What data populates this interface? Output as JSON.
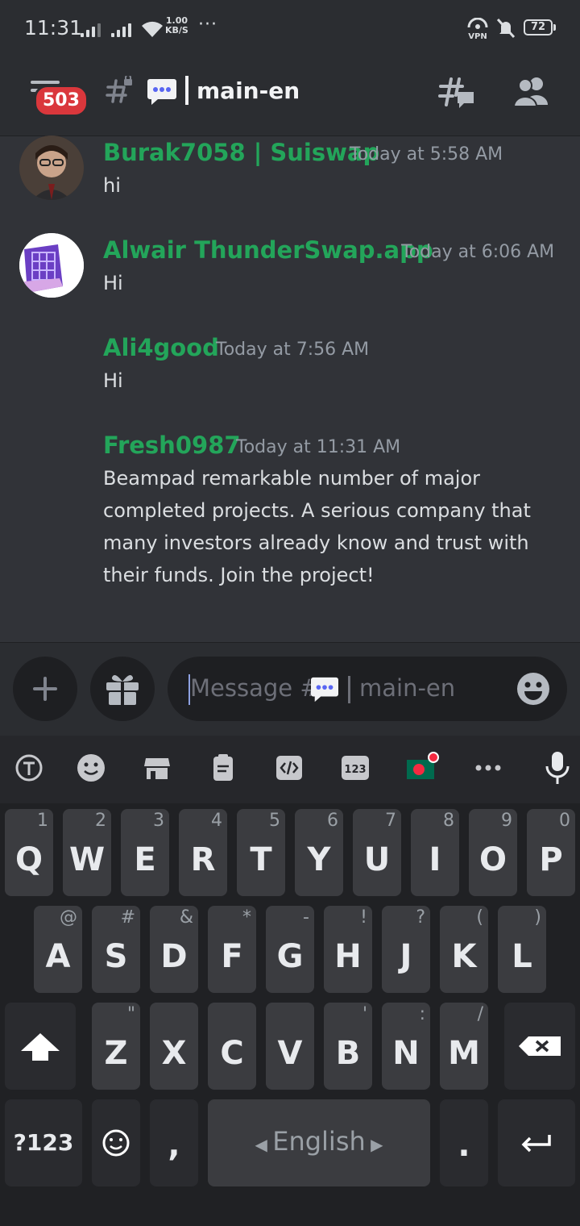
{
  "status_bar": {
    "time": "11:31",
    "net_speed_value": "1.00",
    "net_speed_unit": "KB/S",
    "vpn_label": "VPN",
    "battery_level": "72",
    "more_dots": "···"
  },
  "header": {
    "unread_count": "503",
    "channel_name": "main-en"
  },
  "messages": [
    {
      "author": "Burak7058 | Suiswap",
      "time": "Today at 5:58 AM",
      "text": "hi",
      "has_avatar": true
    },
    {
      "author": "Alwair ThunderSwap.app",
      "time": "Today at 6:06 AM",
      "text": "Hi",
      "has_avatar": true
    },
    {
      "author": "Ali4good",
      "time": "Today at 7:56 AM",
      "text": "Hi",
      "has_avatar": false
    },
    {
      "author": "Fresh0987",
      "time": "Today at 11:31 AM",
      "text": "Beampad remarkable number of major completed projects. A serious company that many investors already know and trust with their funds. Join the project!",
      "has_avatar": false
    }
  ],
  "composer": {
    "placeholder_prefix": "Message #",
    "placeholder_channel": "main-en"
  },
  "keyboard": {
    "row1": [
      {
        "key": "Q",
        "hint": "1"
      },
      {
        "key": "W",
        "hint": "2"
      },
      {
        "key": "E",
        "hint": "3"
      },
      {
        "key": "R",
        "hint": "4"
      },
      {
        "key": "T",
        "hint": "5"
      },
      {
        "key": "Y",
        "hint": "6"
      },
      {
        "key": "U",
        "hint": "7"
      },
      {
        "key": "I",
        "hint": "8"
      },
      {
        "key": "O",
        "hint": "9"
      },
      {
        "key": "P",
        "hint": "0"
      }
    ],
    "row2": [
      {
        "key": "A",
        "hint": "@"
      },
      {
        "key": "S",
        "hint": "#"
      },
      {
        "key": "D",
        "hint": "&"
      },
      {
        "key": "F",
        "hint": "*"
      },
      {
        "key": "G",
        "hint": "-"
      },
      {
        "key": "H",
        "hint": "!"
      },
      {
        "key": "J",
        "hint": "?"
      },
      {
        "key": "K",
        "hint": "("
      },
      {
        "key": "L",
        "hint": ")"
      }
    ],
    "row3": [
      {
        "key": "Z",
        "hint": "\""
      },
      {
        "key": "X",
        "hint": ""
      },
      {
        "key": "C",
        "hint": ""
      },
      {
        "key": "V",
        "hint": ""
      },
      {
        "key": "B",
        "hint": "'"
      },
      {
        "key": "N",
        "hint": ":"
      },
      {
        "key": "M",
        "hint": "/"
      }
    ],
    "symbols_key": "?123",
    "comma_key": ",",
    "period_key": ".",
    "space_label": "English"
  },
  "colors": {
    "author_green": "#23a55a",
    "badge_red": "#da373c",
    "background": "#313338",
    "blurple_cursor": "#8ea1e1"
  }
}
